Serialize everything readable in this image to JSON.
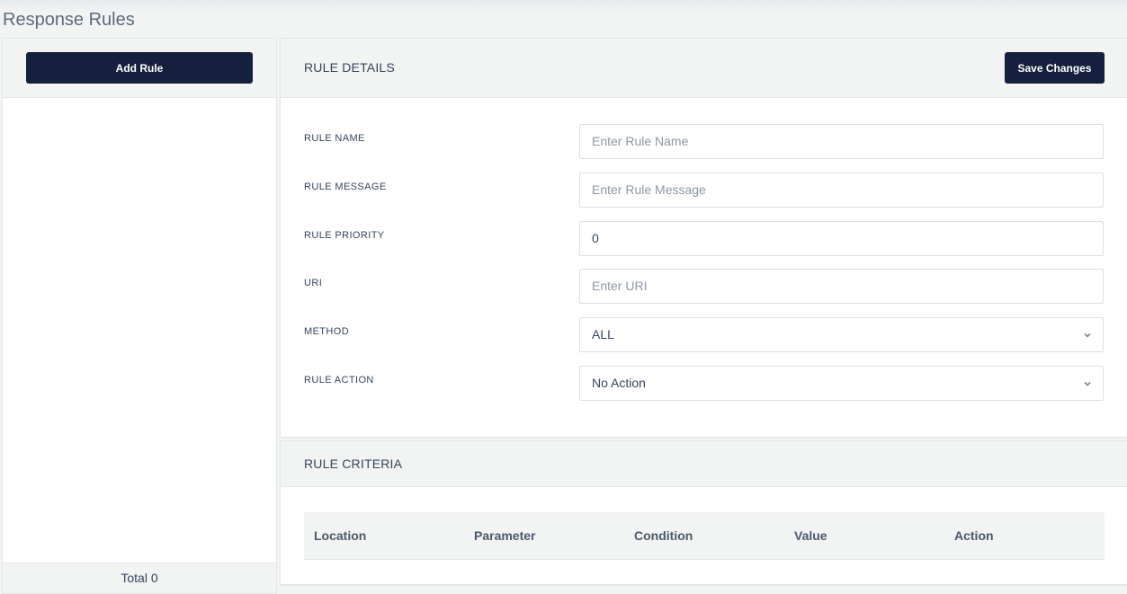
{
  "page": {
    "title": "Response Rules"
  },
  "sidebar": {
    "add_rule_label": "Add Rule",
    "total_label": "Total 0"
  },
  "details": {
    "title": "RULE DETAILS",
    "save_label": "Save Changes",
    "fields": {
      "rule_name": {
        "label": "RULE NAME",
        "placeholder": "Enter Rule Name",
        "value": ""
      },
      "rule_message": {
        "label": "RULE MESSAGE",
        "placeholder": "Enter Rule Message",
        "value": ""
      },
      "rule_priority": {
        "label": "RULE PRIORITY",
        "value": "0"
      },
      "uri": {
        "label": "URI",
        "placeholder": "Enter URI",
        "value": ""
      },
      "method": {
        "label": "METHOD",
        "selected": "ALL"
      },
      "rule_action": {
        "label": "RULE ACTION",
        "selected": "No Action"
      }
    }
  },
  "criteria": {
    "title": "RULE CRITERIA",
    "columns": [
      "Location",
      "Parameter",
      "Condition",
      "Value",
      "Action"
    ]
  },
  "icons": {
    "select_arrow": "chevron-down-icon"
  },
  "colors": {
    "button_bg": "#15203d",
    "panel_bg": "#f2f3f3",
    "text": "#34465c"
  }
}
